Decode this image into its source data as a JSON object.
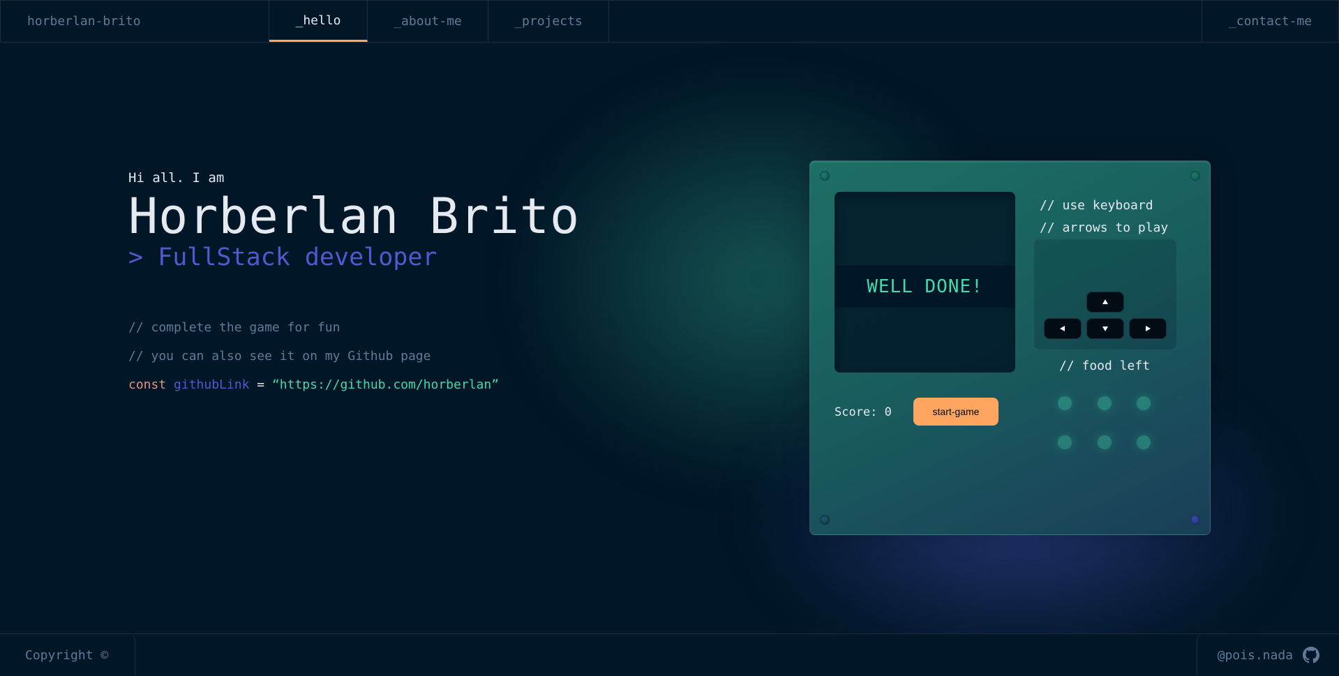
{
  "header": {
    "brand": "horberlan-brito",
    "tabs": [
      {
        "label": "_hello",
        "active": true
      },
      {
        "label": "_about-me",
        "active": false
      },
      {
        "label": "_projects",
        "active": false
      }
    ],
    "contact": "_contact-me"
  },
  "hero": {
    "greeting": "Hi all. I am",
    "name": "Horberlan Brito",
    "role": "> FullStack developer",
    "comment_1": "// complete the game for fun",
    "comment_2": "// you can also see it on my Github page",
    "code": {
      "keyword": "const",
      "variable": "githubLink",
      "operator": "=",
      "value": "“https://github.com/horberlan”"
    }
  },
  "game": {
    "banner": "WELL DONE!",
    "hint_line_1": "// use keyboard",
    "hint_line_2": "// arrows to play",
    "food_label": "// food left",
    "score_label": "Score:",
    "score_value": "0",
    "start_button": "start-game",
    "food_count": 6
  },
  "footer": {
    "copyright": "Copyright ©",
    "handle": "@pois.nada"
  },
  "colors": {
    "background": "#011627",
    "accent_orange": "#FEA55F",
    "accent_teal": "#43D9AD",
    "accent_indigo": "#4D5BCE",
    "keyword_pink": "#E99287",
    "muted_text": "#607B96",
    "light_text": "#E5E9F0"
  },
  "icons": [
    "arrow-up-icon",
    "arrow-left-icon",
    "arrow-down-icon",
    "arrow-right-icon",
    "github-icon"
  ]
}
